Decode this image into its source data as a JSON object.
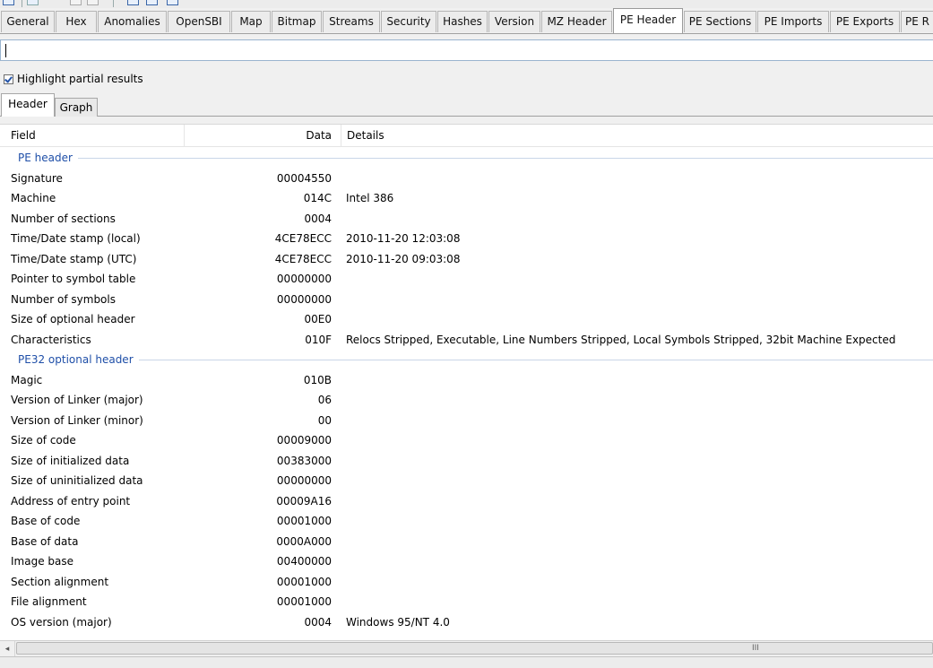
{
  "tabs": [
    {
      "label": "General"
    },
    {
      "label": "Hex"
    },
    {
      "label": "Anomalies"
    },
    {
      "label": "OpenSBI"
    },
    {
      "label": "Map"
    },
    {
      "label": "Bitmap"
    },
    {
      "label": "Streams"
    },
    {
      "label": "Security"
    },
    {
      "label": "Hashes"
    },
    {
      "label": "Version"
    },
    {
      "label": "MZ Header"
    },
    {
      "label": "PE Header"
    },
    {
      "label": "PE Sections"
    },
    {
      "label": "PE Imports"
    },
    {
      "label": "PE Exports"
    },
    {
      "label": "PE R"
    }
  ],
  "active_tab": "PE Header",
  "filter": {
    "value": ""
  },
  "highlight": {
    "label": "Highlight partial results",
    "checked": true
  },
  "subtabs": [
    {
      "label": "Header"
    },
    {
      "label": "Graph"
    }
  ],
  "active_subtab": "Header",
  "columns": {
    "field": "Field",
    "data": "Data",
    "details": "Details"
  },
  "groups": [
    {
      "title": "PE header",
      "rows": [
        {
          "field": "Signature",
          "data": "00004550",
          "details": ""
        },
        {
          "field": "Machine",
          "data": "014C",
          "details": "Intel 386"
        },
        {
          "field": "Number of sections",
          "data": "0004",
          "details": ""
        },
        {
          "field": "Time/Date stamp (local)",
          "data": "4CE78ECC",
          "details": "2010-11-20 12:03:08"
        },
        {
          "field": "Time/Date stamp (UTC)",
          "data": "4CE78ECC",
          "details": "2010-11-20 09:03:08"
        },
        {
          "field": "Pointer to symbol table",
          "data": "00000000",
          "details": ""
        },
        {
          "field": "Number of symbols",
          "data": "00000000",
          "details": ""
        },
        {
          "field": "Size of optional header",
          "data": "00E0",
          "details": ""
        },
        {
          "field": "Characteristics",
          "data": "010F",
          "details": "Relocs Stripped, Executable, Line Numbers Stripped, Local Symbols Stripped, 32bit Machine Expected"
        }
      ]
    },
    {
      "title": "PE32 optional header",
      "rows": [
        {
          "field": "Magic",
          "data": "010B",
          "details": ""
        },
        {
          "field": "Version of Linker (major)",
          "data": "06",
          "details": ""
        },
        {
          "field": "Version of Linker (minor)",
          "data": "00",
          "details": ""
        },
        {
          "field": "Size of code",
          "data": "00009000",
          "details": ""
        },
        {
          "field": "Size of initialized data",
          "data": "00383000",
          "details": ""
        },
        {
          "field": "Size of uninitialized data",
          "data": "00000000",
          "details": ""
        },
        {
          "field": "Address of entry point",
          "data": "00009A16",
          "details": ""
        },
        {
          "field": "Base of code",
          "data": "00001000",
          "details": ""
        },
        {
          "field": "Base of data",
          "data": "0000A000",
          "details": ""
        },
        {
          "field": "Image base",
          "data": "00400000",
          "details": ""
        },
        {
          "field": "Section alignment",
          "data": "00001000",
          "details": ""
        },
        {
          "field": "File alignment",
          "data": "00001000",
          "details": ""
        },
        {
          "field": "OS version (major)",
          "data": "0004",
          "details": "Windows 95/NT 4.0"
        }
      ]
    }
  ],
  "scrollbar": {
    "left_arrow": "◂",
    "grip": "III"
  }
}
